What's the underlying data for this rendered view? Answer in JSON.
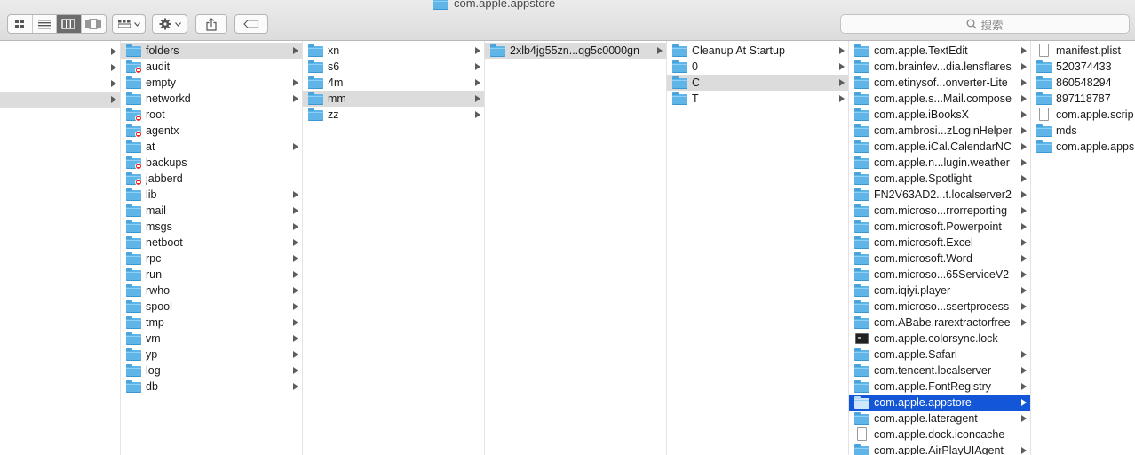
{
  "window": {
    "title": "com.apple.appstore"
  },
  "toolbar": {
    "view_buttons": [
      "icon-view-icon",
      "list-view-icon",
      "column-view-icon",
      "cover-flow-view-icon"
    ],
    "active_view": "column-view-icon",
    "search_placeholder": "搜索"
  },
  "columns": [
    {
      "rows": [
        {
          "name": "",
          "has_arrow": true
        },
        {
          "name": "",
          "has_arrow": true
        },
        {
          "name": "",
          "has_arrow": true
        },
        {
          "name": "",
          "has_arrow": true,
          "state": "sel"
        }
      ]
    },
    {
      "rows": [
        {
          "name": "folders",
          "icon": "folder",
          "has_arrow": true,
          "state": "sel"
        },
        {
          "name": "audit",
          "icon": "folder-restricted",
          "has_arrow": false
        },
        {
          "name": "empty",
          "icon": "folder",
          "has_arrow": true
        },
        {
          "name": "networkd",
          "icon": "folder",
          "has_arrow": true
        },
        {
          "name": "root",
          "icon": "folder-restricted",
          "has_arrow": false
        },
        {
          "name": "agentx",
          "icon": "folder-restricted",
          "has_arrow": false
        },
        {
          "name": "at",
          "icon": "folder",
          "has_arrow": true
        },
        {
          "name": "backups",
          "icon": "folder-restricted",
          "has_arrow": false
        },
        {
          "name": "jabberd",
          "icon": "folder-restricted",
          "has_arrow": false
        },
        {
          "name": "lib",
          "icon": "folder",
          "has_arrow": true
        },
        {
          "name": "mail",
          "icon": "folder",
          "has_arrow": true
        },
        {
          "name": "msgs",
          "icon": "folder",
          "has_arrow": true
        },
        {
          "name": "netboot",
          "icon": "folder",
          "has_arrow": true
        },
        {
          "name": "rpc",
          "icon": "folder",
          "has_arrow": true
        },
        {
          "name": "run",
          "icon": "folder",
          "has_arrow": true
        },
        {
          "name": "rwho",
          "icon": "folder",
          "has_arrow": true
        },
        {
          "name": "spool",
          "icon": "folder",
          "has_arrow": true
        },
        {
          "name": "tmp",
          "icon": "folder",
          "has_arrow": true
        },
        {
          "name": "vm",
          "icon": "folder",
          "has_arrow": true
        },
        {
          "name": "yp",
          "icon": "folder",
          "has_arrow": true
        },
        {
          "name": "log",
          "icon": "folder",
          "has_arrow": true
        },
        {
          "name": "db",
          "icon": "folder",
          "has_arrow": true
        }
      ]
    },
    {
      "rows": [
        {
          "name": "xn",
          "icon": "folder",
          "has_arrow": true
        },
        {
          "name": "s6",
          "icon": "folder",
          "has_arrow": true
        },
        {
          "name": "4m",
          "icon": "folder",
          "has_arrow": true
        },
        {
          "name": "mm",
          "icon": "folder",
          "has_arrow": true,
          "state": "sel"
        },
        {
          "name": "zz",
          "icon": "folder",
          "has_arrow": true
        }
      ]
    },
    {
      "rows": [
        {
          "name": "2xlb4jg55zn...qg5c0000gn",
          "icon": "folder",
          "has_arrow": true,
          "state": "sel"
        }
      ]
    },
    {
      "rows": [
        {
          "name": "Cleanup At Startup",
          "icon": "folder",
          "has_arrow": true
        },
        {
          "name": "0",
          "icon": "folder",
          "has_arrow": true
        },
        {
          "name": "C",
          "icon": "folder",
          "has_arrow": true,
          "state": "sel"
        },
        {
          "name": "T",
          "icon": "folder",
          "has_arrow": true
        }
      ]
    },
    {
      "rows": [
        {
          "name": "com.apple.TextEdit",
          "icon": "folder",
          "has_arrow": true
        },
        {
          "name": "com.brainfev...dia.lensflares",
          "icon": "folder",
          "has_arrow": true
        },
        {
          "name": "com.etinysof...onverter-Lite",
          "icon": "folder",
          "has_arrow": true
        },
        {
          "name": "com.apple.s...Mail.compose",
          "icon": "folder",
          "has_arrow": true
        },
        {
          "name": "com.apple.iBooksX",
          "icon": "folder",
          "has_arrow": true
        },
        {
          "name": "com.ambrosi...zLoginHelper",
          "icon": "folder",
          "has_arrow": true
        },
        {
          "name": "com.apple.iCal.CalendarNC",
          "icon": "folder",
          "has_arrow": true
        },
        {
          "name": "com.apple.n...lugin.weather",
          "icon": "folder",
          "has_arrow": true
        },
        {
          "name": "com.apple.Spotlight",
          "icon": "folder",
          "has_arrow": true
        },
        {
          "name": "FN2V63AD2...t.localserver2",
          "icon": "folder",
          "has_arrow": true
        },
        {
          "name": "com.microso...rrorreporting",
          "icon": "folder",
          "has_arrow": true
        },
        {
          "name": "com.microsoft.Powerpoint",
          "icon": "folder",
          "has_arrow": true
        },
        {
          "name": "com.microsoft.Excel",
          "icon": "folder",
          "has_arrow": true
        },
        {
          "name": "com.microsoft.Word",
          "icon": "folder",
          "has_arrow": true
        },
        {
          "name": "com.microso...65ServiceV2",
          "icon": "folder",
          "has_arrow": true
        },
        {
          "name": "com.iqiyi.player",
          "icon": "folder",
          "has_arrow": true
        },
        {
          "name": "com.microso...ssertprocess",
          "icon": "folder",
          "has_arrow": true
        },
        {
          "name": "com.ABabe.rarextractorfree",
          "icon": "folder",
          "has_arrow": true
        },
        {
          "name": "com.apple.colorsync.lock",
          "icon": "terminal",
          "has_arrow": false
        },
        {
          "name": "com.apple.Safari",
          "icon": "folder",
          "has_arrow": true
        },
        {
          "name": "com.tencent.localserver",
          "icon": "folder",
          "has_arrow": true
        },
        {
          "name": "com.apple.FontRegistry",
          "icon": "folder",
          "has_arrow": true
        },
        {
          "name": "com.apple.appstore",
          "icon": "folder",
          "has_arrow": true,
          "state": "active"
        },
        {
          "name": "com.apple.lateragent",
          "icon": "folder",
          "has_arrow": true
        },
        {
          "name": "com.apple.dock.iconcache",
          "icon": "document",
          "has_arrow": false
        },
        {
          "name": "com.apple.AirPlayUIAgent",
          "icon": "folder",
          "has_arrow": true
        }
      ]
    },
    {
      "rows": [
        {
          "name": "manifest.plist",
          "icon": "document",
          "has_arrow": false
        },
        {
          "name": "520374433",
          "icon": "folder",
          "has_arrow": false
        },
        {
          "name": "860548294",
          "icon": "folder",
          "has_arrow": false
        },
        {
          "name": "897118787",
          "icon": "folder",
          "has_arrow": false
        },
        {
          "name": "com.apple.scrip",
          "icon": "document",
          "has_arrow": false
        },
        {
          "name": "mds",
          "icon": "folder",
          "has_arrow": false
        },
        {
          "name": "com.apple.apps",
          "icon": "folder",
          "has_arrow": false
        }
      ]
    }
  ],
  "colors": {
    "selection_active": "#1356d7",
    "selection_inactive": "#dcdcdc",
    "folder": "#5fb4e8",
    "restricted_badge": "#e0231b"
  }
}
